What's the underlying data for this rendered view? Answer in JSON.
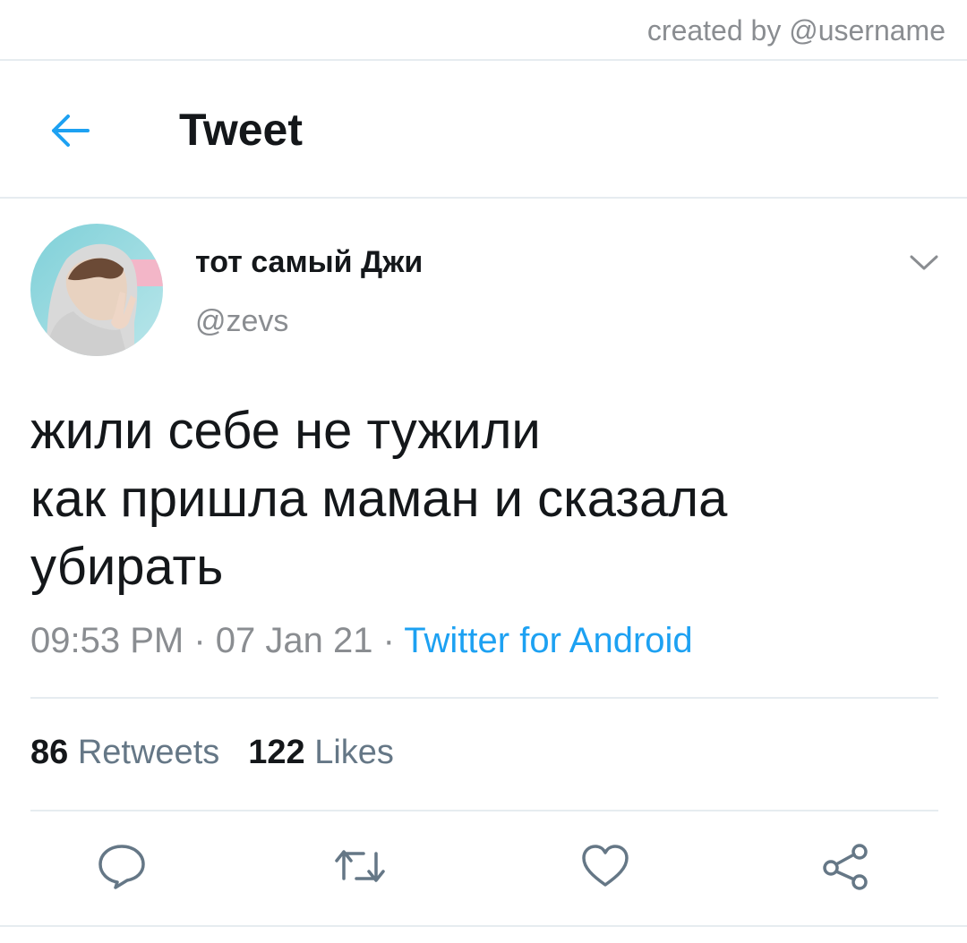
{
  "credit": "created by @username",
  "header": {
    "title": "Tweet",
    "back_icon": "arrow-left-icon",
    "accent_color": "#1da1f2"
  },
  "author": {
    "display_name": "тот самый Джи",
    "handle": "@zevs",
    "more_icon": "chevron-down-icon"
  },
  "tweet": {
    "lines": [
      "жили себе не тужили",
      "как пришла маман и сказала",
      "убирать"
    ],
    "time": "09:53 PM",
    "sep1": " · ",
    "date": "07 Jan 21",
    "sep2": " · ",
    "source": "Twitter for Android"
  },
  "stats": {
    "retweets_count": "86",
    "retweets_label": "Retweets",
    "likes_count": "122",
    "likes_label": "Likes"
  },
  "actions": {
    "reply_icon": "reply-icon",
    "retweet_icon": "retweet-icon",
    "like_icon": "heart-icon",
    "share_icon": "share-icon"
  }
}
